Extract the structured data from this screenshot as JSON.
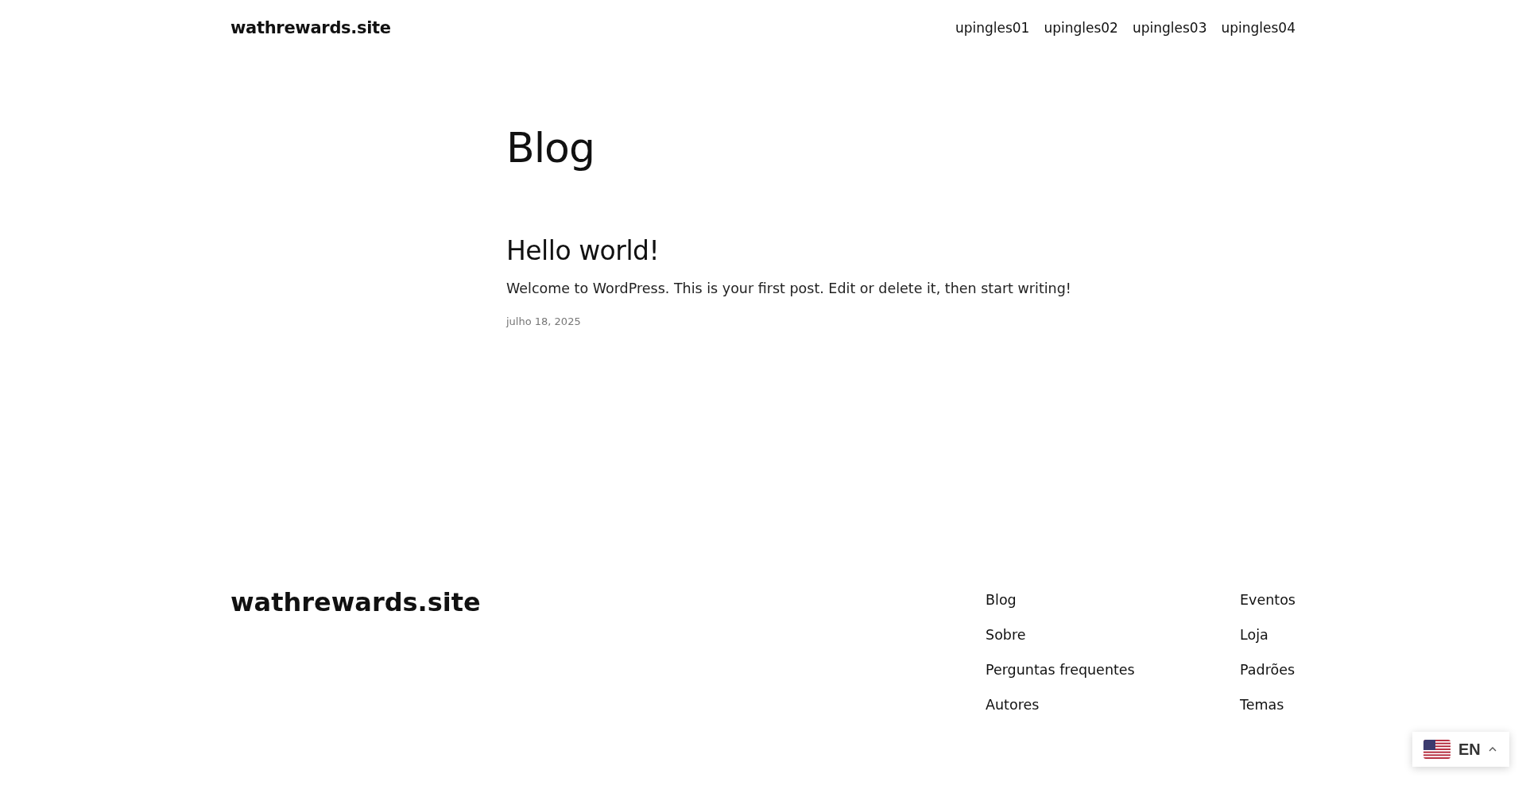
{
  "header": {
    "site_title": "wathrewards.site",
    "nav": [
      "upingles01",
      "upingles02",
      "upingles03",
      "upingles04"
    ]
  },
  "page_title": "Blog",
  "posts": [
    {
      "title": "Hello world!",
      "excerpt": "Welcome to WordPress. This is your first post. Edit or delete it, then start writing!",
      "date": "julho 18, 2025"
    }
  ],
  "footer": {
    "site_title": "wathrewards.site",
    "columns": [
      [
        "Blog",
        "Sobre",
        "Perguntas frequentes",
        "Autores"
      ],
      [
        "Eventos",
        "Loja",
        "Padrões",
        "Temas"
      ]
    ]
  },
  "language_switcher": {
    "label": "EN",
    "expanded": false
  }
}
